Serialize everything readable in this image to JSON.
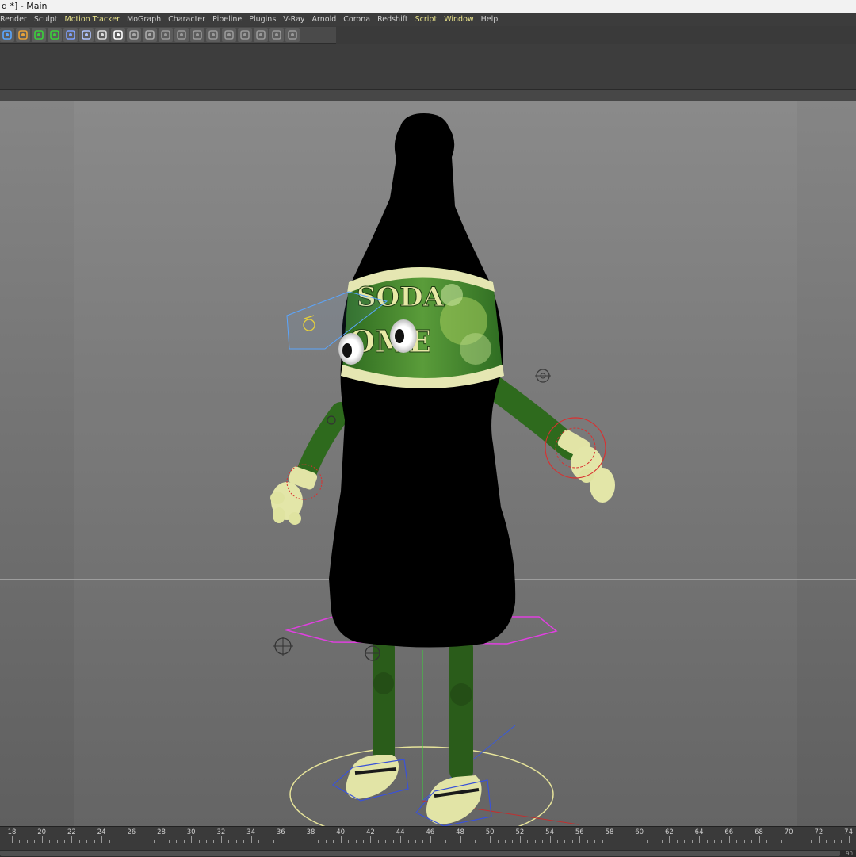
{
  "window": {
    "title": "d *] - Main"
  },
  "menu": {
    "items": [
      {
        "label": "Render",
        "hl": false
      },
      {
        "label": "Sculpt",
        "hl": false
      },
      {
        "label": "Motion Tracker",
        "hl": true
      },
      {
        "label": "MoGraph",
        "hl": false
      },
      {
        "label": "Character",
        "hl": false
      },
      {
        "label": "Pipeline",
        "hl": false
      },
      {
        "label": "Plugins",
        "hl": false
      },
      {
        "label": "V-Ray",
        "hl": false
      },
      {
        "label": "Arnold",
        "hl": false
      },
      {
        "label": "Corona",
        "hl": false
      },
      {
        "label": "Redshift",
        "hl": false
      },
      {
        "label": "Script",
        "hl": true
      },
      {
        "label": "Window",
        "hl": true
      },
      {
        "label": "Help",
        "hl": false
      }
    ]
  },
  "toolbar": {
    "icons": [
      "cube-icon",
      "pen-icon",
      "subdivision-icon",
      "array-icon",
      "deformer-icon",
      "floor-icon",
      "camera-icon",
      "light-icon",
      "grid-tool-icon",
      "grid-tool-icon",
      "polygon-icon",
      "joint-icon",
      "ik-icon",
      "weight-icon",
      "pose-icon",
      "morph-icon",
      "cluster-icon",
      "mesh-icon",
      "mesh-icon"
    ]
  },
  "viewport": {
    "label_top": "SODA",
    "label_bottom": "OME"
  },
  "timeline": {
    "ticks": [
      "18",
      "20",
      "22",
      "24",
      "26",
      "28",
      "30",
      "32",
      "34",
      "36",
      "38",
      "40",
      "42",
      "44",
      "46",
      "48",
      "50",
      "52",
      "54",
      "56",
      "58",
      "60",
      "62",
      "64",
      "66",
      "68",
      "70",
      "72",
      "74"
    ],
    "end_label": "90"
  },
  "colors": {
    "accent_menu": "#e8e28a",
    "bottle": "#000000",
    "limb_green": "#2f6b1e",
    "glove": "#e3e6a8"
  }
}
